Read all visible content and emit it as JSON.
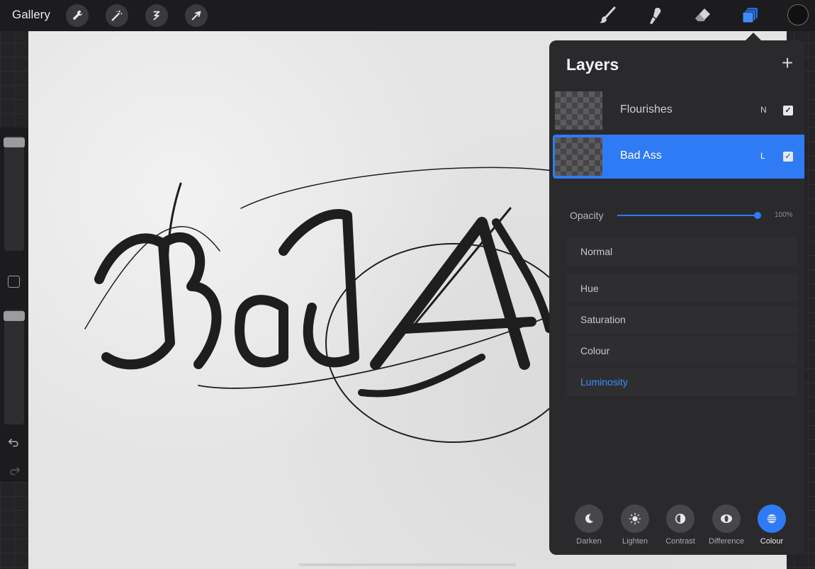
{
  "app": {
    "gallery_label": "Gallery"
  },
  "toolbar": {
    "left_tools": [
      "wrench-icon",
      "magic-wand-icon",
      "selection-icon",
      "transform-icon"
    ],
    "right_tools": [
      "brush-icon",
      "smudge-icon",
      "eraser-icon",
      "layers-icon"
    ],
    "active_color": "#111111",
    "accent_color": "#2f7bf5"
  },
  "layers_panel": {
    "title": "Layers",
    "add_label": "+",
    "layers": [
      {
        "name": "Flourishes",
        "blend_mode": "N",
        "visible": true,
        "active": false
      },
      {
        "name": "Bad Ass",
        "blend_mode": "L",
        "visible": true,
        "active": true
      }
    ],
    "opacity_label": "Opacity",
    "opacity_value": "100%",
    "blend_modes": [
      "Normal",
      "Hue",
      "Saturation",
      "Colour",
      "Luminosity"
    ],
    "selected_blend_mode": "Luminosity",
    "mode_categories": [
      "Darken",
      "Lighten",
      "Contrast",
      "Difference",
      "Colour"
    ],
    "selected_category": "Colour"
  }
}
